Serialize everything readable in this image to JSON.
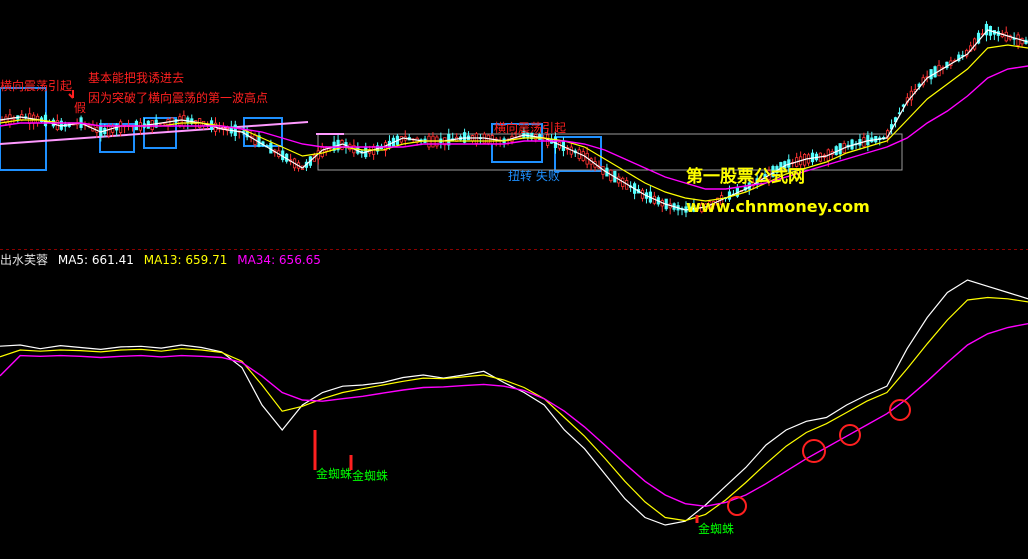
{
  "indicator_legend": {
    "name": "出水芙蓉",
    "ma5_label": "MA5: 661.41",
    "ma13_label": "MA13: 659.71",
    "ma34_label": "MA34: 656.65"
  },
  "annotations": {
    "top_left_note": "横向震荡引起",
    "note_2": "基本能把我诱进去",
    "note_3": "因为突破了横向震荡的第一波高点",
    "note_small": "假",
    "note_mid": "横向震荡引起",
    "note_fail": "扭转 失败"
  },
  "watermark": {
    "title": "第一股票公式网",
    "url": "www.chnmoney.com"
  },
  "signals": [
    {
      "label": "金蜘蛛"
    },
    {
      "label": "金蜘蛛"
    },
    {
      "label": "金蜘蛛"
    }
  ],
  "colors": {
    "background": "#000000",
    "ma5": "#ffffff",
    "ma13": "#ffff00",
    "ma34": "#ff00ff",
    "candle_up": "#ff3333",
    "candle_down": "#54ffff",
    "annotation_red": "#ff2020",
    "annotation_blue": "#1e90ff",
    "signal_green": "#00ff00",
    "watermark": "#ffff00"
  },
  "chart_data": [
    {
      "type": "line",
      "panel": "price",
      "y_axis_labels_visible": false,
      "grid": false,
      "x": [
        0,
        1,
        2,
        3,
        4,
        5,
        6,
        7,
        8,
        9,
        10,
        11,
        12,
        13,
        14,
        15,
        16,
        17,
        18,
        19,
        20,
        21,
        22,
        23,
        24,
        25,
        26,
        27,
        28,
        29,
        30,
        31,
        32,
        33,
        34,
        35,
        36,
        37,
        38,
        39,
        40,
        41,
        42,
        43,
        44,
        45,
        46,
        47,
        48,
        49,
        50,
        51
      ],
      "series": [
        {
          "values": [
            52,
            53,
            52,
            50,
            51,
            48,
            50,
            50,
            51,
            52,
            51,
            49,
            48,
            44,
            40,
            36,
            42,
            44,
            41,
            43,
            46,
            45,
            45,
            46,
            46,
            45,
            47,
            46,
            43,
            40,
            35,
            31,
            27,
            24,
            22,
            23,
            26,
            29,
            33,
            37,
            39,
            40,
            43,
            45,
            46,
            58,
            66,
            70,
            74,
            82,
            80,
            78
          ]
        },
        {
          "values": [
            51,
            52,
            52,
            51,
            51,
            50,
            50,
            50,
            50,
            51,
            51,
            50,
            49,
            46,
            43,
            40,
            41,
            43,
            42,
            42,
            44,
            45,
            45,
            45,
            45,
            45,
            46,
            46,
            45,
            43,
            39,
            35,
            31,
            28,
            26,
            25,
            26,
            28,
            31,
            34,
            36,
            38,
            41,
            43,
            45,
            52,
            59,
            64,
            69,
            76,
            77,
            76
          ]
        },
        {
          "values": [
            50,
            51,
            51,
            51,
            51,
            50,
            50,
            50,
            50,
            50,
            50,
            50,
            49,
            48,
            46,
            44,
            43,
            43,
            43,
            43,
            43,
            44,
            44,
            44,
            44,
            44,
            45,
            45,
            45,
            44,
            42,
            39,
            36,
            33,
            31,
            29,
            29,
            30,
            31,
            33,
            35,
            37,
            39,
            41,
            43,
            46,
            51,
            55,
            60,
            66,
            69,
            70
          ]
        }
      ]
    },
    {
      "type": "line",
      "panel": "indicator",
      "y_axis_labels_visible": false,
      "grid": false,
      "x": [
        0,
        1,
        2,
        3,
        4,
        5,
        6,
        7,
        8,
        9,
        10,
        11,
        12,
        13,
        14,
        15,
        16,
        17,
        18,
        19,
        20,
        21,
        22,
        23,
        24,
        25,
        26,
        27,
        28,
        29,
        30,
        31,
        32,
        33,
        34,
        35,
        36,
        37,
        38,
        39,
        40,
        41,
        42,
        43,
        44,
        45,
        46,
        47,
        48,
        49,
        50,
        51
      ],
      "series": [
        {
          "values": [
            661.41,
            661.6,
            661.0,
            661.5,
            661.2,
            660.9,
            661.3,
            661.4,
            661.1,
            661.6,
            661.2,
            660.5,
            658.0,
            652.0,
            648.0,
            652.0,
            654.0,
            655.0,
            655.2,
            655.6,
            656.4,
            656.8,
            656.3,
            656.8,
            657.4,
            655.6,
            654.0,
            652.0,
            648.0,
            645.0,
            641.0,
            637.0,
            634.0,
            632.8,
            633.4,
            636.0,
            639.0,
            642.0,
            645.6,
            648.0,
            649.4,
            650.0,
            652.0,
            653.6,
            655.0,
            661.0,
            666.0,
            670.0,
            672.0,
            671.0,
            670.0,
            669.0
          ]
        },
        {
          "values": [
            659.71,
            660.8,
            660.6,
            660.8,
            660.7,
            660.5,
            660.8,
            660.9,
            660.6,
            661.0,
            660.8,
            660.4,
            659.0,
            655.2,
            651.0,
            651.8,
            653.0,
            654.0,
            654.6,
            655.2,
            655.8,
            656.3,
            656.2,
            656.5,
            656.8,
            656.0,
            654.8,
            653.0,
            650.0,
            647.0,
            643.5,
            639.8,
            636.5,
            634.0,
            633.5,
            634.5,
            636.8,
            639.6,
            642.6,
            645.4,
            647.6,
            649.0,
            650.8,
            652.6,
            654.0,
            657.8,
            661.8,
            665.6,
            668.8,
            669.2,
            669.0,
            668.5
          ]
        },
        {
          "values": [
            656.65,
            659.9,
            659.8,
            659.9,
            659.8,
            659.6,
            659.8,
            659.9,
            659.7,
            659.9,
            659.8,
            659.6,
            658.8,
            656.6,
            654.0,
            652.8,
            652.6,
            653.0,
            653.4,
            653.9,
            654.4,
            654.8,
            654.9,
            655.1,
            655.3,
            655.0,
            654.3,
            653.0,
            651.0,
            648.5,
            645.6,
            642.6,
            639.8,
            637.6,
            636.2,
            635.8,
            636.4,
            637.6,
            639.4,
            641.4,
            643.4,
            645.2,
            647.0,
            648.8,
            650.6,
            653.0,
            655.8,
            658.8,
            661.6,
            663.4,
            664.4,
            665.0
          ]
        }
      ]
    }
  ]
}
